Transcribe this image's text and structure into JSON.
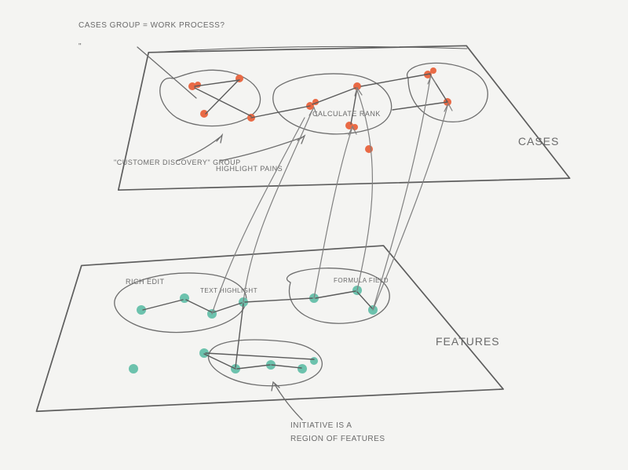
{
  "topPlane": {
    "label": "CASES",
    "annotation_top": "CASES GROUP = WORK PROCESS?",
    "group_left_label": "\"CUSTOMER DISCOVERY\" GROUP",
    "edge_label_1": "highlight pains",
    "node_label_1": "CALCULATE RANK",
    "dot_color": "#e96a45"
  },
  "bottomPlane": {
    "label": "FEATURES",
    "node_label_left": "RICH EDIT",
    "node_label_mid": "TEXT HIGHLIGHT",
    "node_label_right": "FORMULA FIELD",
    "annotation_bottom": "INITIATIVE IS A REGION OF FEATURES",
    "dot_color": "#6cc2ad"
  }
}
